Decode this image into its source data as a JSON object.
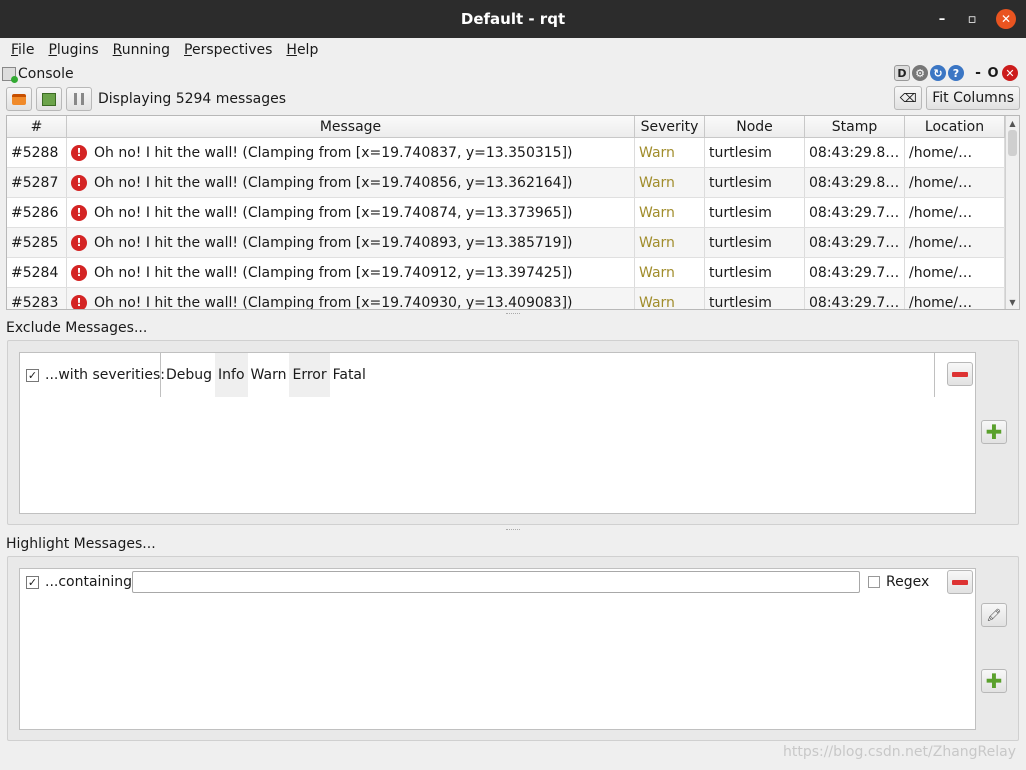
{
  "window": {
    "title": "Default - rqt",
    "min_glyph": "–",
    "max_glyph": "▫",
    "close_glyph": "✕"
  },
  "menu": [
    {
      "label_u": "F",
      "label_rest": "ile"
    },
    {
      "label_u": "P",
      "label_rest": "lugins"
    },
    {
      "label_u": "R",
      "label_rest": "unning"
    },
    {
      "label_u": "P",
      "label_rest": "erspectives"
    },
    {
      "label_u": "H",
      "label_rest": "elp"
    }
  ],
  "console": {
    "title": "Console",
    "plugin_icons": {
      "d": "D",
      "dash": "-",
      "o": "O"
    },
    "display_text": "Displaying 5294 messages",
    "fit_columns_label": "Fit Columns"
  },
  "table": {
    "columns": [
      "#",
      "Message",
      "Severity",
      "Node",
      "Stamp",
      "Location"
    ],
    "rows": [
      {
        "num": "#5288",
        "message": "Oh no! I hit the wall! (Clamping from [x=19.740837, y=13.350315])",
        "severity": "Warn",
        "node": "turtlesim",
        "stamp": "08:43:29.8…",
        "location": "/home/…"
      },
      {
        "num": "#5287",
        "message": "Oh no! I hit the wall! (Clamping from [x=19.740856, y=13.362164])",
        "severity": "Warn",
        "node": "turtlesim",
        "stamp": "08:43:29.8…",
        "location": "/home/…"
      },
      {
        "num": "#5286",
        "message": "Oh no! I hit the wall! (Clamping from [x=19.740874, y=13.373965])",
        "severity": "Warn",
        "node": "turtlesim",
        "stamp": "08:43:29.7…",
        "location": "/home/…"
      },
      {
        "num": "#5285",
        "message": "Oh no! I hit the wall! (Clamping from [x=19.740893, y=13.385719])",
        "severity": "Warn",
        "node": "turtlesim",
        "stamp": "08:43:29.7…",
        "location": "/home/…"
      },
      {
        "num": "#5284",
        "message": "Oh no! I hit the wall! (Clamping from [x=19.740912, y=13.397425])",
        "severity": "Warn",
        "node": "turtlesim",
        "stamp": "08:43:29.7…",
        "location": "/home/…"
      },
      {
        "num": "#5283",
        "message": "Oh no! I hit the wall! (Clamping from [x=19.740930, y=13.409083])",
        "severity": "Warn",
        "node": "turtlesim",
        "stamp": "08:43:29.7…",
        "location": "/home/…"
      }
    ]
  },
  "exclude": {
    "title": "Exclude Messages...",
    "checked_mark": "✓",
    "label": "...with severities:",
    "severities": [
      "Debug",
      "Info",
      "Warn",
      "Error",
      "Fatal"
    ]
  },
  "highlight": {
    "title": "Highlight Messages...",
    "checked_mark": "✓",
    "label": "...containing:",
    "input_value": "",
    "regex_label": "Regex"
  },
  "watermark": "https://blog.csdn.net/ZhangRelay",
  "colors": {
    "warn": "#a18d2c",
    "error_icon": "#d42424",
    "titlebar": "#2c2c2c",
    "close": "#e95420"
  }
}
